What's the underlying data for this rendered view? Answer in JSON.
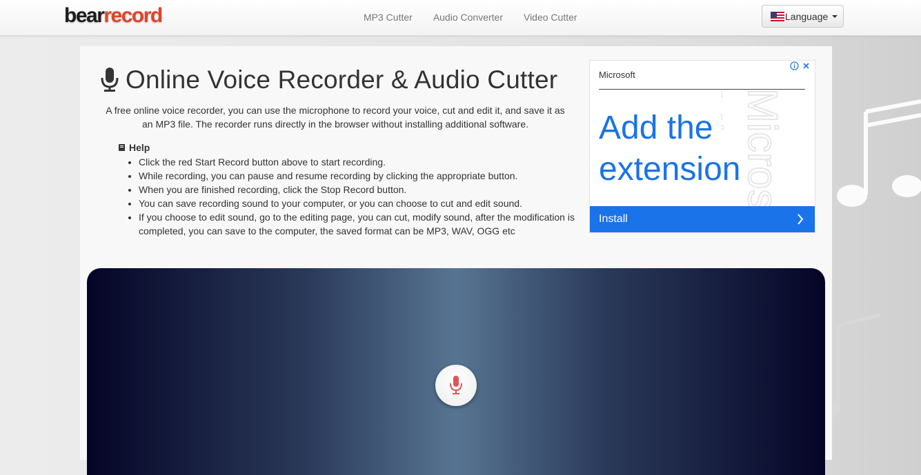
{
  "brand": {
    "logo_part1": "bear",
    "logo_part2": "record"
  },
  "nav": {
    "links": [
      {
        "label": "MP3 Cutter"
      },
      {
        "label": "Audio Converter"
      },
      {
        "label": "Video Cutter"
      }
    ],
    "language_label": "Language"
  },
  "main": {
    "title": "Online Voice Recorder & Audio Cutter",
    "intro": "A free online voice recorder, you can use the microphone to record your voice, cut and edit it, and save it as an MP3 file. The recorder runs directly in the browser without installing additional software.",
    "help": {
      "title": "Help",
      "items": [
        "Click the red Start Record button above to start recording.",
        "While recording, you can pause and resume recording by clicking the appropriate button.",
        "When you are finished recording, click the Stop Record button.",
        "You can save recording sound to your computer, or you can choose to cut and edit sound.",
        "If you choose to edit sound, go to the editing page, you can cut, modify sound, after the modification is completed, you can save to the computer, the saved format can be MP3, WAV, OGG etc"
      ]
    }
  },
  "ad": {
    "brand": "Microsoft",
    "headline": "Add the extension",
    "cta": "Install",
    "watermark": "Micros"
  },
  "colors": {
    "brand_red": "#e0432b",
    "ad_blue": "#1a73e8",
    "mic_red": "#e05555"
  }
}
